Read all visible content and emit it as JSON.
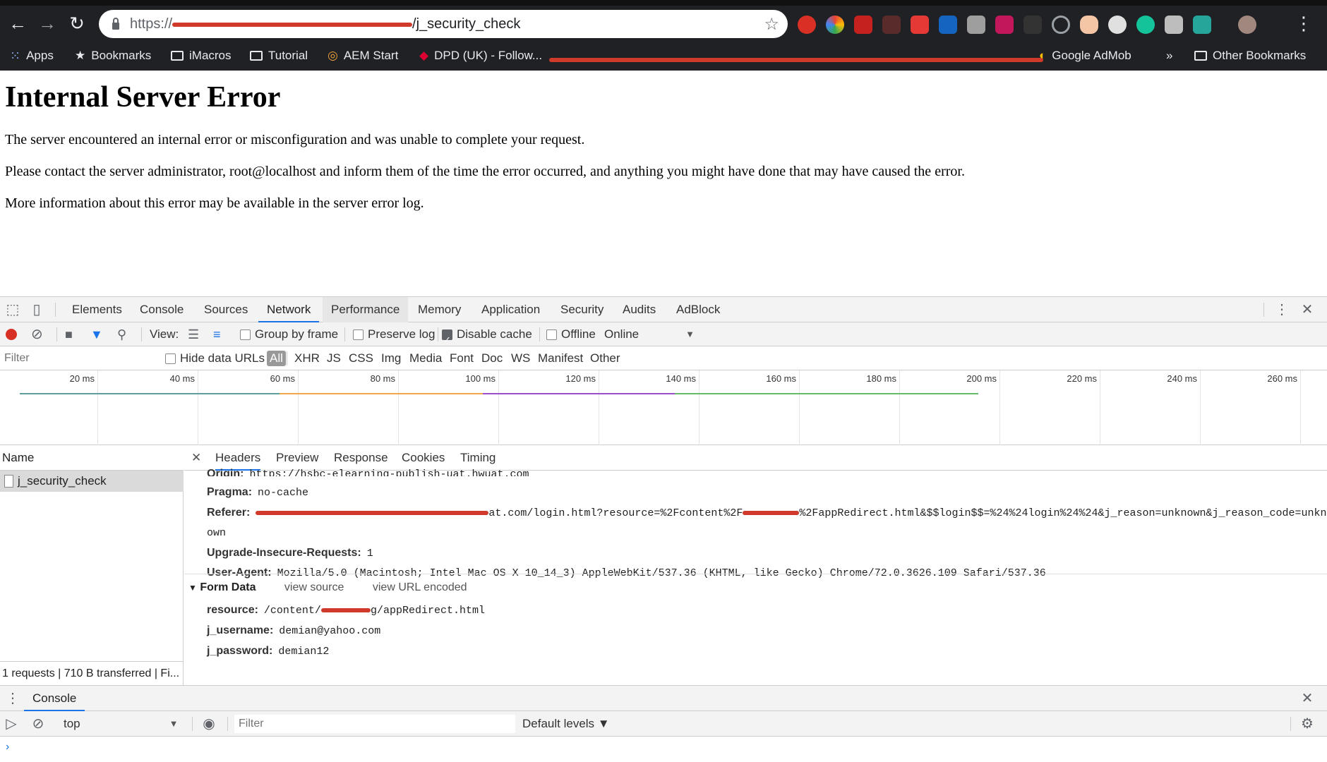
{
  "browser": {
    "url_prefix": "https://",
    "url_suffix": "/j_security_check",
    "bookmarks": [
      {
        "label": "Apps",
        "icon": "apps-grid-icon"
      },
      {
        "label": "Bookmarks",
        "icon": "star-icon"
      },
      {
        "label": "iMacros",
        "icon": "folder-icon"
      },
      {
        "label": "Tutorial",
        "icon": "folder-icon"
      },
      {
        "label": "AEM Start",
        "icon": "aem-icon"
      },
      {
        "label": "DPD (UK) - Follow...",
        "icon": "dpd-icon"
      },
      {
        "label": "Google AdMob",
        "icon": "admob-icon"
      }
    ],
    "overflow_label": "»",
    "other_bookmarks": "Other Bookmarks"
  },
  "page": {
    "title": "Internal Server Error",
    "p1": "The server encountered an internal error or misconfiguration and was unable to complete your request.",
    "p2": "Please contact the server administrator, root@localhost and inform them of the time the error occurred, and anything you might have done that may have caused the error.",
    "p3": "More information about this error may be available in the server error log."
  },
  "devtools": {
    "tabs": [
      "Elements",
      "Console",
      "Sources",
      "Network",
      "Performance",
      "Memory",
      "Application",
      "Security",
      "Audits",
      "AdBlock"
    ],
    "active_tab": "Network",
    "toolbar": {
      "view_label": "View:",
      "group_by_frame": "Group by frame",
      "preserve_log": "Preserve log",
      "disable_cache": "Disable cache",
      "offline": "Offline",
      "throttle": "Online"
    },
    "filter_placeholder": "Filter",
    "hide_data_urls": "Hide data URLs",
    "filter_types": [
      "All",
      "XHR",
      "JS",
      "CSS",
      "Img",
      "Media",
      "Font",
      "Doc",
      "WS",
      "Manifest",
      "Other"
    ],
    "ticks": [
      "20 ms",
      "40 ms",
      "60 ms",
      "80 ms",
      "100 ms",
      "120 ms",
      "140 ms",
      "160 ms",
      "180 ms",
      "200 ms",
      "220 ms",
      "240 ms",
      "260 ms"
    ],
    "name_header": "Name",
    "request_name": "j_security_check",
    "summary": "1 requests | 710 B transferred | Fi...",
    "detail_tabs": [
      "Headers",
      "Preview",
      "Response",
      "Cookies",
      "Timing"
    ],
    "headers": {
      "origin_key": "Origin:",
      "origin_val": "https://hsbc-elearning-publish-uat.hwuat.com",
      "pragma_key": "Pragma:",
      "pragma_val": "no-cache",
      "referer_key": "Referer:",
      "referer_val_end": "at.com/login.html?resource=%2Fcontent%2F",
      "referer_val_tail": "%2FappRedirect.html&$$login$$=%24%24login%24%24&j_reason=unknown&j_reason_code=unkn",
      "referer_wrap": "own",
      "upgrade_key": "Upgrade-Insecure-Requests:",
      "upgrade_val": "1",
      "ua_key": "User-Agent:",
      "ua_val": "Mozilla/5.0 (Macintosh; Intel Mac OS X 10_14_3) AppleWebKit/537.36 (KHTML, like Gecko) Chrome/72.0.3626.109 Safari/537.36"
    },
    "form": {
      "title": "Form Data",
      "view_source": "view source",
      "view_url_encoded": "view URL encoded",
      "resource_key": "resource:",
      "resource_val_a": "/content/",
      "resource_val_b": "g/appRedirect.html",
      "username_key": "j_username:",
      "username_val": "demian@yahoo.com",
      "password_key": "j_password:",
      "password_val": "demian12"
    },
    "console": {
      "tab": "Console",
      "context": "top",
      "filter_placeholder": "Filter",
      "levels": "Default levels ▼",
      "prompt": "›"
    }
  }
}
